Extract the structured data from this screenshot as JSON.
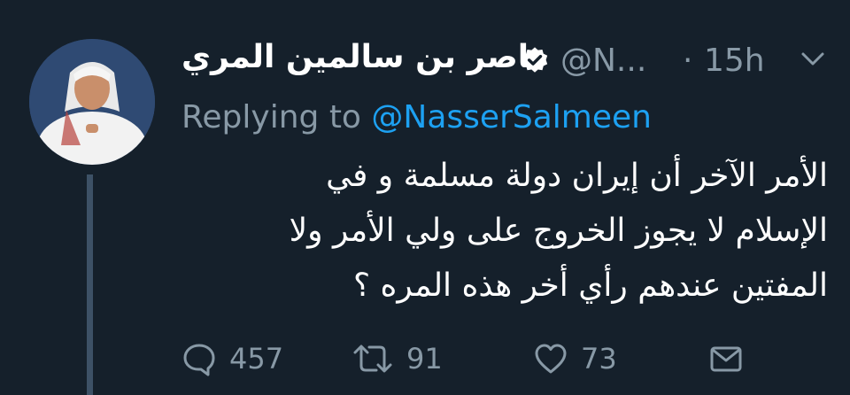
{
  "tweet": {
    "author_name": "ناصر بن سالمين المري",
    "handle": "@N...",
    "separator": "·",
    "time": "15h",
    "replying_label": "Replying to",
    "replying_to": "@NasserSalmeen",
    "text_lines": [
      "الأمر الآخر أن إيران دولة مسلمة و في",
      "الإسلام لا يجوز الخروج على ولي الأمر ولا",
      "المفتين عندهم رأي أخر هذه المره ؟"
    ],
    "reply_count": "457",
    "retweet_count": "91",
    "like_count": "73"
  },
  "icons": {
    "verified": "verified-badge-icon",
    "caret": "chevron-down-icon",
    "reply": "reply-bubble-icon",
    "retweet": "retweet-icon",
    "like": "heart-icon",
    "dm": "envelope-icon"
  },
  "colors": {
    "background": "#15202b",
    "secondary_text": "#8899a6",
    "link": "#1da1f2",
    "thread_line": "#3d5166"
  }
}
